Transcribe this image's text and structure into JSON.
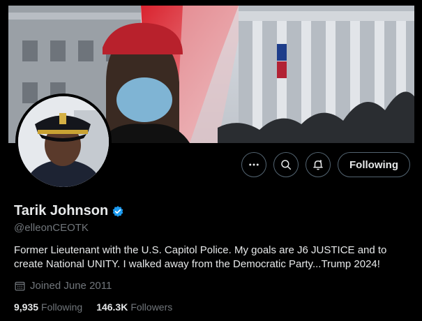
{
  "profile": {
    "display_name": "Tarik Johnson",
    "handle": "@elleonCEOTK",
    "bio": "Former Lieutenant with the U.S. Capitol Police. My goals are J6 JUSTICE and to create National UNITY. I walked away from the Democratic Party...Trump 2024!",
    "joined": "Joined June 2011"
  },
  "actions": {
    "follow_label": "Following",
    "more_icon": "more-icon",
    "search_icon": "search-icon",
    "notify_icon": "notification-bell-icon"
  },
  "stats": {
    "following_count": "9,935",
    "following_label": "Following",
    "followers_count": "146.3K",
    "followers_label": "Followers"
  },
  "colors": {
    "background": "#000000",
    "text_primary": "#e7e9ea",
    "text_secondary": "#71767b",
    "border": "#536471",
    "verified": "#1d9bf0"
  }
}
